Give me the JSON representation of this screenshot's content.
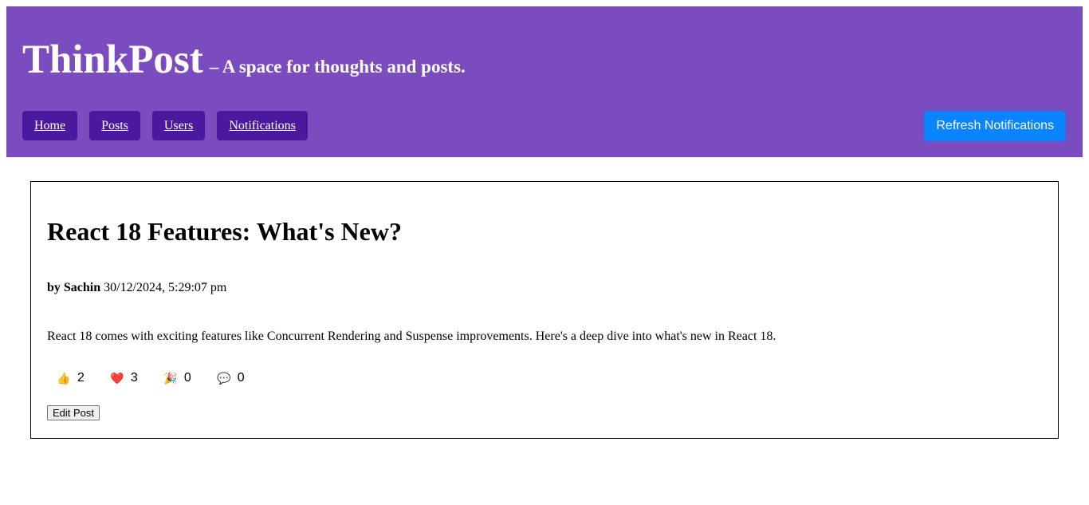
{
  "header": {
    "title": "ThinkPost",
    "subtitle": "– A space for thoughts and posts.",
    "background": "#7a4cbf",
    "nav": [
      {
        "label": "Home"
      },
      {
        "label": "Posts"
      },
      {
        "label": "Users"
      },
      {
        "label": "Notifications"
      }
    ],
    "refresh_label": "Refresh Notifications",
    "refresh_color": "#0a84ff"
  },
  "post": {
    "title": "React 18 Features: What's New?",
    "by_label": "by Sachin",
    "timestamp": "30/12/2024, 5:29:07 pm",
    "body": "React 18 comes with exciting features like Concurrent Rendering and Suspense improvements. Here's a deep dive into what's new in React 18.",
    "reactions": [
      {
        "icon": "👍",
        "name": "thumbs-up-icon",
        "count": "2"
      },
      {
        "icon": "❤️",
        "name": "heart-icon",
        "count": "3"
      },
      {
        "icon": "🎉",
        "name": "party-popper-icon",
        "count": "0"
      },
      {
        "icon": "💬",
        "name": "speech-bubble-icon",
        "count": "0"
      }
    ],
    "edit_label": "Edit Post"
  }
}
